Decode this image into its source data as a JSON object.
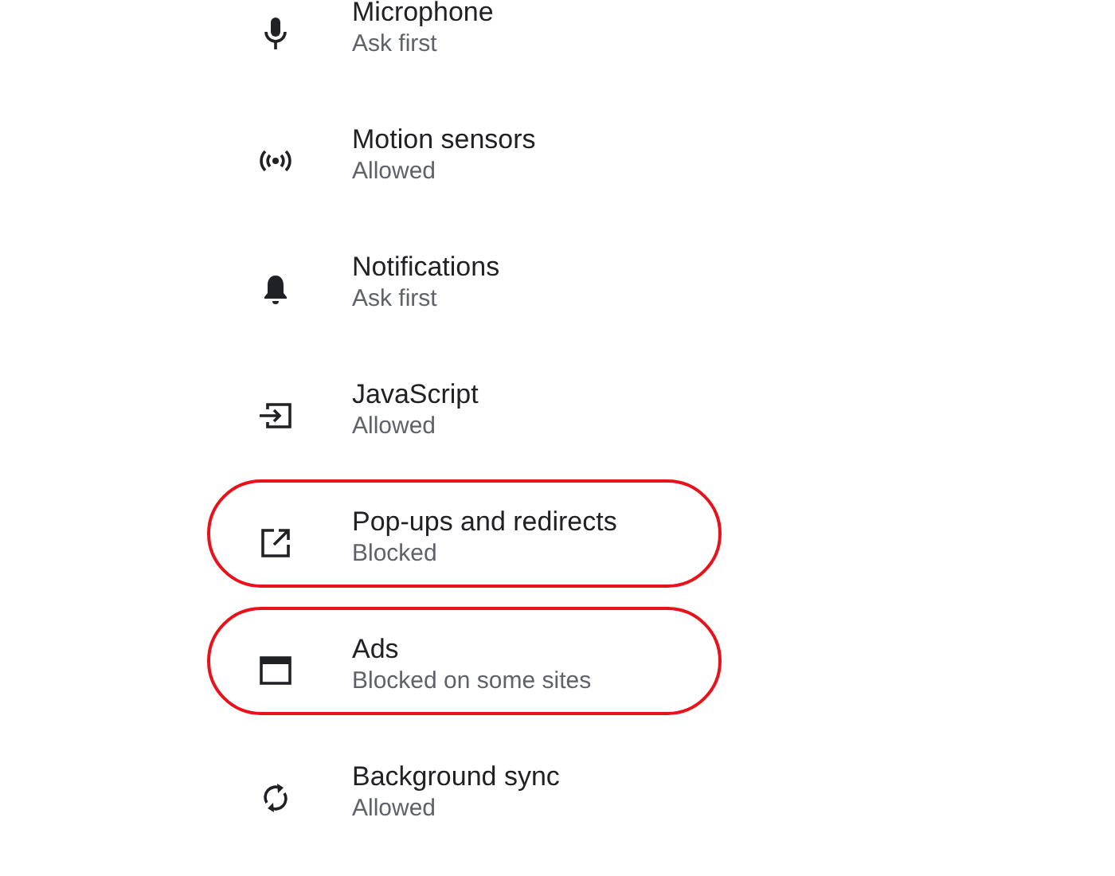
{
  "settings": [
    {
      "kind": "mic",
      "title": "Microphone",
      "subtitle": "Ask first",
      "highlighted": false
    },
    {
      "kind": "sensors",
      "title": "Motion sensors",
      "subtitle": "Allowed",
      "highlighted": false
    },
    {
      "kind": "bell",
      "title": "Notifications",
      "subtitle": "Ask first",
      "highlighted": false
    },
    {
      "kind": "javascript",
      "title": "JavaScript",
      "subtitle": "Allowed",
      "highlighted": false
    },
    {
      "kind": "popup",
      "title": "Pop-ups and redirects",
      "subtitle": "Blocked",
      "highlighted": true
    },
    {
      "kind": "ads",
      "title": "Ads",
      "subtitle": "Blocked on some sites",
      "highlighted": true
    },
    {
      "kind": "sync",
      "title": "Background sync",
      "subtitle": "Allowed",
      "highlighted": false
    }
  ]
}
